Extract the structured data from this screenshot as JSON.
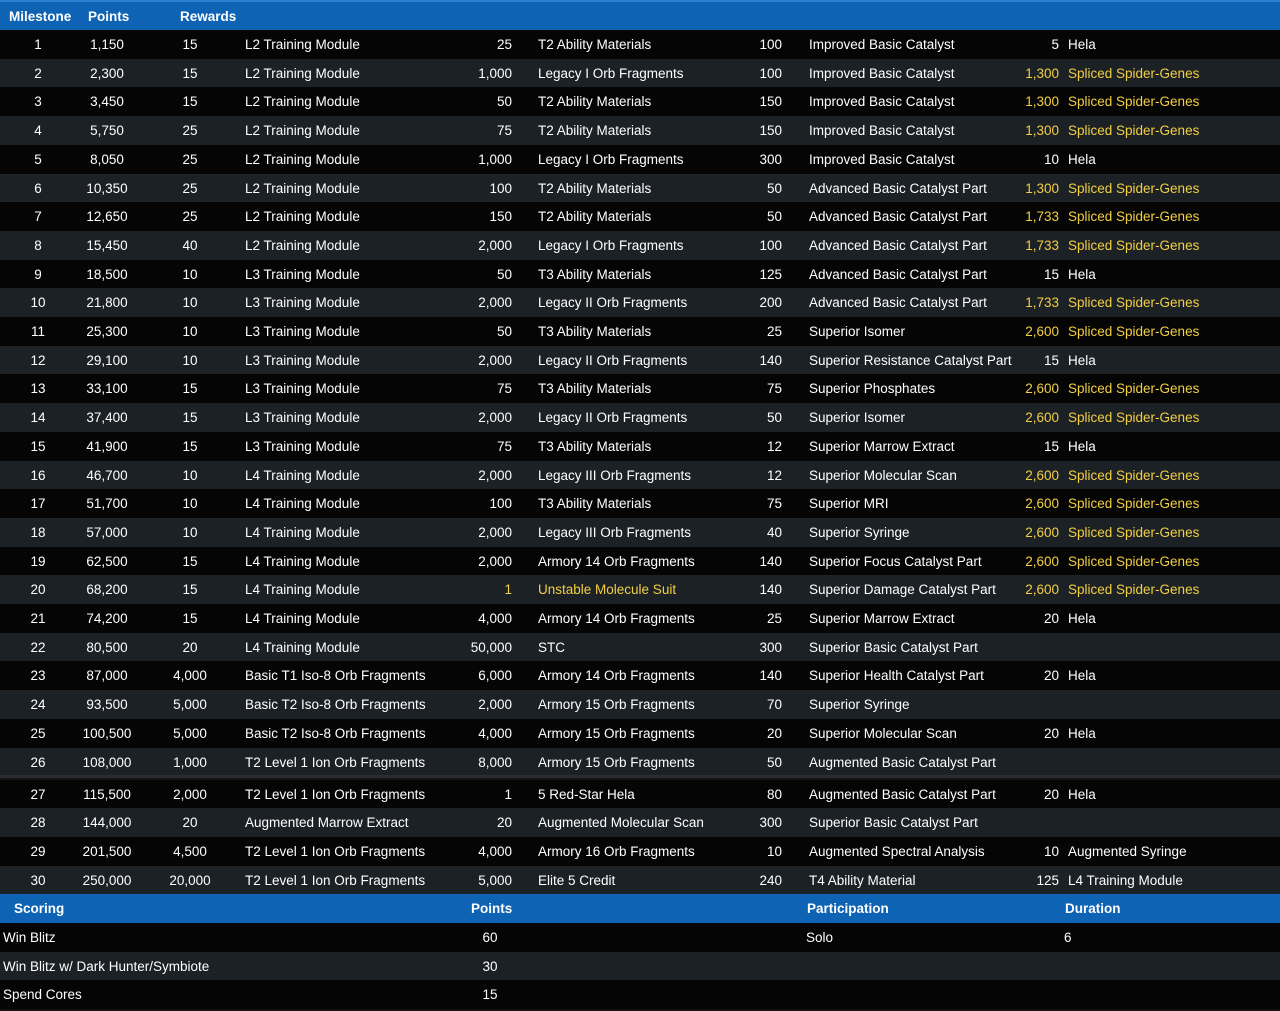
{
  "milestone_header": {
    "milestone": "Milestone",
    "points": "Points",
    "rewards": "Rewards"
  },
  "milestones": [
    {
      "milestone": "1",
      "points": "1,150",
      "r1_qty": "15",
      "r1_item": "L2 Training Module",
      "r2_qty": "25",
      "r2_item": "T2 Ability Materials",
      "r3_qty": "100",
      "r3_item": "Improved Basic Catalyst",
      "r4_qty": "5",
      "r4_item": "Hela"
    },
    {
      "milestone": "2",
      "points": "2,300",
      "r1_qty": "15",
      "r1_item": "L2 Training Module",
      "r2_qty": "1,000",
      "r2_item": "Legacy I Orb Fragments",
      "r3_qty": "100",
      "r3_item": "Improved Basic Catalyst",
      "r4_qty": "1,300",
      "r4_item": "Spliced Spider-Genes"
    },
    {
      "milestone": "3",
      "points": "3,450",
      "r1_qty": "15",
      "r1_item": "L2 Training Module",
      "r2_qty": "50",
      "r2_item": "T2 Ability Materials",
      "r3_qty": "150",
      "r3_item": "Improved Basic Catalyst",
      "r4_qty": "1,300",
      "r4_item": "Spliced Spider-Genes"
    },
    {
      "milestone": "4",
      "points": "5,750",
      "r1_qty": "25",
      "r1_item": "L2 Training Module",
      "r2_qty": "75",
      "r2_item": "T2 Ability Materials",
      "r3_qty": "150",
      "r3_item": "Improved Basic Catalyst",
      "r4_qty": "1,300",
      "r4_item": "Spliced Spider-Genes"
    },
    {
      "milestone": "5",
      "points": "8,050",
      "r1_qty": "25",
      "r1_item": "L2 Training Module",
      "r2_qty": "1,000",
      "r2_item": "Legacy I Orb Fragments",
      "r3_qty": "300",
      "r3_item": "Improved Basic Catalyst",
      "r4_qty": "10",
      "r4_item": "Hela"
    },
    {
      "milestone": "6",
      "points": "10,350",
      "r1_qty": "25",
      "r1_item": "L2 Training Module",
      "r2_qty": "100",
      "r2_item": "T2 Ability Materials",
      "r3_qty": "50",
      "r3_item": "Advanced Basic Catalyst Part",
      "r4_qty": "1,300",
      "r4_item": "Spliced Spider-Genes"
    },
    {
      "milestone": "7",
      "points": "12,650",
      "r1_qty": "25",
      "r1_item": "L2 Training Module",
      "r2_qty": "150",
      "r2_item": "T2 Ability Materials",
      "r3_qty": "50",
      "r3_item": "Advanced Basic Catalyst Part",
      "r4_qty": "1,733",
      "r4_item": "Spliced Spider-Genes"
    },
    {
      "milestone": "8",
      "points": "15,450",
      "r1_qty": "40",
      "r1_item": "L2 Training Module",
      "r2_qty": "2,000",
      "r2_item": "Legacy I Orb Fragments",
      "r3_qty": "100",
      "r3_item": "Advanced Basic Catalyst Part",
      "r4_qty": "1,733",
      "r4_item": "Spliced Spider-Genes"
    },
    {
      "milestone": "9",
      "points": "18,500",
      "r1_qty": "10",
      "r1_item": "L3 Training Module",
      "r2_qty": "50",
      "r2_item": "T3 Ability Materials",
      "r3_qty": "125",
      "r3_item": "Advanced Basic Catalyst Part",
      "r4_qty": "15",
      "r4_item": "Hela"
    },
    {
      "milestone": "10",
      "points": "21,800",
      "r1_qty": "10",
      "r1_item": "L3 Training Module",
      "r2_qty": "2,000",
      "r2_item": "Legacy II Orb Fragments",
      "r3_qty": "200",
      "r3_item": "Advanced Basic Catalyst Part",
      "r4_qty": "1,733",
      "r4_item": "Spliced Spider-Genes"
    },
    {
      "milestone": "11",
      "points": "25,300",
      "r1_qty": "10",
      "r1_item": "L3 Training Module",
      "r2_qty": "50",
      "r2_item": "T3 Ability Materials",
      "r3_qty": "25",
      "r3_item": "Superior Isomer",
      "r4_qty": "2,600",
      "r4_item": "Spliced Spider-Genes"
    },
    {
      "milestone": "12",
      "points": "29,100",
      "r1_qty": "10",
      "r1_item": "L3 Training Module",
      "r2_qty": "2,000",
      "r2_item": "Legacy II Orb Fragments",
      "r3_qty": "140",
      "r3_item": "Superior Resistance Catalyst Part",
      "r4_qty": "15",
      "r4_item": "Hela"
    },
    {
      "milestone": "13",
      "points": "33,100",
      "r1_qty": "15",
      "r1_item": "L3 Training Module",
      "r2_qty": "75",
      "r2_item": "T3 Ability Materials",
      "r3_qty": "75",
      "r3_item": "Superior Phosphates",
      "r4_qty": "2,600",
      "r4_item": "Spliced Spider-Genes"
    },
    {
      "milestone": "14",
      "points": "37,400",
      "r1_qty": "15",
      "r1_item": "L3 Training Module",
      "r2_qty": "2,000",
      "r2_item": "Legacy II Orb Fragments",
      "r3_qty": "50",
      "r3_item": "Superior Isomer",
      "r4_qty": "2,600",
      "r4_item": "Spliced Spider-Genes"
    },
    {
      "milestone": "15",
      "points": "41,900",
      "r1_qty": "15",
      "r1_item": "L3 Training Module",
      "r2_qty": "75",
      "r2_item": "T3 Ability Materials",
      "r3_qty": "12",
      "r3_item": "Superior Marrow Extract",
      "r4_qty": "15",
      "r4_item": "Hela"
    },
    {
      "milestone": "16",
      "points": "46,700",
      "r1_qty": "10",
      "r1_item": "L4 Training Module",
      "r2_qty": "2,000",
      "r2_item": "Legacy III Orb Fragments",
      "r3_qty": "12",
      "r3_item": "Superior Molecular Scan",
      "r4_qty": "2,600",
      "r4_item": "Spliced Spider-Genes"
    },
    {
      "milestone": "17",
      "points": "51,700",
      "r1_qty": "10",
      "r1_item": "L4 Training Module",
      "r2_qty": "100",
      "r2_item": "T3 Ability Materials",
      "r3_qty": "75",
      "r3_item": "Superior MRI",
      "r4_qty": "2,600",
      "r4_item": "Spliced Spider-Genes"
    },
    {
      "milestone": "18",
      "points": "57,000",
      "r1_qty": "10",
      "r1_item": "L4 Training Module",
      "r2_qty": "2,000",
      "r2_item": "Legacy III Orb Fragments",
      "r3_qty": "40",
      "r3_item": "Superior Syringe",
      "r4_qty": "2,600",
      "r4_item": "Spliced Spider-Genes"
    },
    {
      "milestone": "19",
      "points": "62,500",
      "r1_qty": "15",
      "r1_item": "L4 Training Module",
      "r2_qty": "2,000",
      "r2_item": "Armory 14 Orb Fragments",
      "r3_qty": "140",
      "r3_item": "Superior Focus Catalyst Part",
      "r4_qty": "2,600",
      "r4_item": "Spliced Spider-Genes"
    },
    {
      "milestone": "20",
      "points": "68,200",
      "r1_qty": "15",
      "r1_item": "L4 Training Module",
      "r2_qty": "1",
      "r2_item": "Unstable Molecule Suit",
      "r3_qty": "140",
      "r3_item": "Superior Damage Catalyst Part",
      "r4_qty": "2,600",
      "r4_item": "Spliced Spider-Genes"
    },
    {
      "milestone": "21",
      "points": "74,200",
      "r1_qty": "15",
      "r1_item": "L4 Training Module",
      "r2_qty": "4,000",
      "r2_item": "Armory 14 Orb Fragments",
      "r3_qty": "25",
      "r3_item": "Superior Marrow Extract",
      "r4_qty": "20",
      "r4_item": "Hela"
    },
    {
      "milestone": "22",
      "points": "80,500",
      "r1_qty": "20",
      "r1_item": "L4 Training Module",
      "r2_qty": "50,000",
      "r2_item": "STC",
      "r3_qty": "300",
      "r3_item": "Superior Basic Catalyst Part",
      "r4_qty": "",
      "r4_item": ""
    },
    {
      "milestone": "23",
      "points": "87,000",
      "r1_qty": "4,000",
      "r1_item": "Basic T1 Iso-8 Orb Fragments",
      "r2_qty": "6,000",
      "r2_item": "Armory 14 Orb Fragments",
      "r3_qty": "140",
      "r3_item": "Superior Health Catalyst Part",
      "r4_qty": "20",
      "r4_item": "Hela"
    },
    {
      "milestone": "24",
      "points": "93,500",
      "r1_qty": "5,000",
      "r1_item": "Basic T2 Iso-8 Orb Fragments",
      "r2_qty": "2,000",
      "r2_item": "Armory 15 Orb Fragments",
      "r3_qty": "70",
      "r3_item": "Superior Syringe",
      "r4_qty": "",
      "r4_item": ""
    },
    {
      "milestone": "25",
      "points": "100,500",
      "r1_qty": "5,000",
      "r1_item": "Basic T2 Iso-8 Orb Fragments",
      "r2_qty": "4,000",
      "r2_item": "Armory 15 Orb Fragments",
      "r3_qty": "20",
      "r3_item": "Superior Molecular Scan",
      "r4_qty": "20",
      "r4_item": "Hela"
    },
    {
      "milestone": "26",
      "points": "108,000",
      "r1_qty": "1,000",
      "r1_item": "T2 Level 1 Ion Orb Fragments",
      "r2_qty": "8,000",
      "r2_item": "Armory 15 Orb Fragments",
      "r3_qty": "50",
      "r3_item": "Augmented Basic Catalyst Part",
      "r4_qty": "",
      "r4_item": ""
    },
    {
      "milestone": "27",
      "points": "115,500",
      "r1_qty": "2,000",
      "r1_item": "T2 Level 1 Ion Orb Fragments",
      "r2_qty": "1",
      "r2_item": "5 Red-Star Hela",
      "r3_qty": "80",
      "r3_item": "Augmented Basic Catalyst Part",
      "r4_qty": "20",
      "r4_item": "Hela"
    },
    {
      "milestone": "28",
      "points": "144,000",
      "r1_qty": "20",
      "r1_item": "Augmented Marrow Extract",
      "r2_qty": "20",
      "r2_item": "Augmented Molecular Scan",
      "r3_qty": "300",
      "r3_item": "Superior Basic Catalyst Part",
      "r4_qty": "",
      "r4_item": ""
    },
    {
      "milestone": "29",
      "points": "201,500",
      "r1_qty": "4,500",
      "r1_item": "T2 Level 1 Ion Orb Fragments",
      "r2_qty": "4,000",
      "r2_item": "Armory 16 Orb Fragments",
      "r3_qty": "10",
      "r3_item": "Augmented Spectral Analysis",
      "r4_qty": "10",
      "r4_item": "Augmented Syringe"
    },
    {
      "milestone": "30",
      "points": "250,000",
      "r1_qty": "20,000",
      "r1_item": "T2 Level 1 Ion Orb Fragments",
      "r2_qty": "5,000",
      "r2_item": "Elite 5 Credit",
      "r3_qty": "240",
      "r3_item": "T4 Ability Material",
      "r4_qty": "125",
      "r4_item": "L4 Training Module"
    }
  ],
  "highlight_items": [
    "Spliced Spider-Genes",
    "Unstable Molecule Suit"
  ],
  "scoring_header": {
    "scoring": "Scoring",
    "points": "Points",
    "participation": "Participation",
    "duration": "Duration"
  },
  "scoring": [
    {
      "label": "Win Blitz",
      "points": "60",
      "participation": "Solo",
      "duration": "6"
    },
    {
      "label": "Win Blitz w/ Dark Hunter/Symbiote",
      "points": "30",
      "participation": "",
      "duration": ""
    },
    {
      "label": "Spend Cores",
      "points": "15",
      "participation": "",
      "duration": ""
    }
  ],
  "colors": {
    "header_bg": "#0f63b4",
    "row_dark": "#050505",
    "row_light": "#1c2126",
    "highlight": "#f2cf43"
  }
}
